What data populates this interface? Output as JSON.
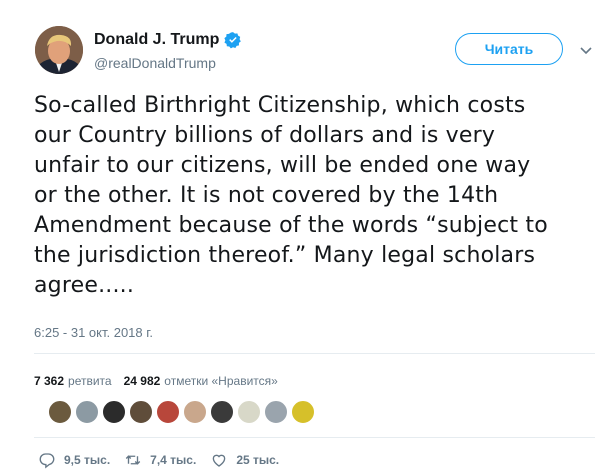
{
  "author": {
    "display_name": "Donald J. Trump",
    "handle": "@realDonaldTrump",
    "verified": true
  },
  "follow_button": {
    "label": "Читать"
  },
  "tweet": {
    "text": "So-called Birthright Citizenship, which costs\nour Country billions of dollars and is very\nunfair to our citizens, will be ended one way\nor the other. It is not covered by the 14th\nAmendment because of the words “subject to\nthe jurisdiction thereof.” Many legal scholars\nagree.....",
    "timestamp": "6:25 - 31 окт. 2018 г."
  },
  "stats": {
    "retweets_count": "7 362",
    "retweets_label": "ретвита",
    "likes_count": "24 982",
    "likes_label": "отметки «Нравится»"
  },
  "liker_avatar_colors": [
    "#6b5a3e",
    "#8c9aa3",
    "#2b2b2b",
    "#5f4d3a",
    "#b8473b",
    "#c9a78c",
    "#3a3a3a",
    "#d8d8c8",
    "#9aa4ad",
    "#d6c02a"
  ],
  "actions": {
    "replies": "9,5 тыс.",
    "retweets": "7,4 тыс.",
    "likes": "25 тыс."
  },
  "colors": {
    "accent": "#1da1f2",
    "text": "#14171a",
    "secondary": "#657786"
  },
  "icons": [
    "verified-badge-icon",
    "chevron-down-icon",
    "reply-icon",
    "retweet-icon",
    "like-icon"
  ]
}
